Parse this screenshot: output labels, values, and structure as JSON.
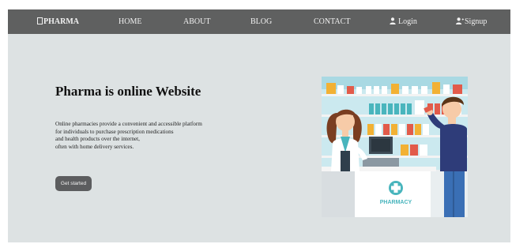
{
  "nav": {
    "brand": "PHARMA",
    "home": "HOME",
    "about": "ABOUT",
    "blog": "BLOG",
    "contact": "CONTACT",
    "login": "Login",
    "signup": "Signup"
  },
  "hero": {
    "title": "Pharma is online Website",
    "description_lines": [
      "Online pharmacies provide a convenient and accessible platform",
      "for individuals to purchase prescription medications",
      "and health products over the internet,",
      "often with home delivery services."
    ],
    "cta_label": "Get started",
    "image_sign": "PHARMACY"
  },
  "colors": {
    "navbar": "#5f6060",
    "page_background": "#dde2e3",
    "button": "#5c5d5f",
    "pharmacy_teal": "#49b5bd"
  },
  "icons": {
    "login": "user-icon",
    "signup": "user-plus-icon",
    "brand": "pharmacy-logo-icon"
  }
}
